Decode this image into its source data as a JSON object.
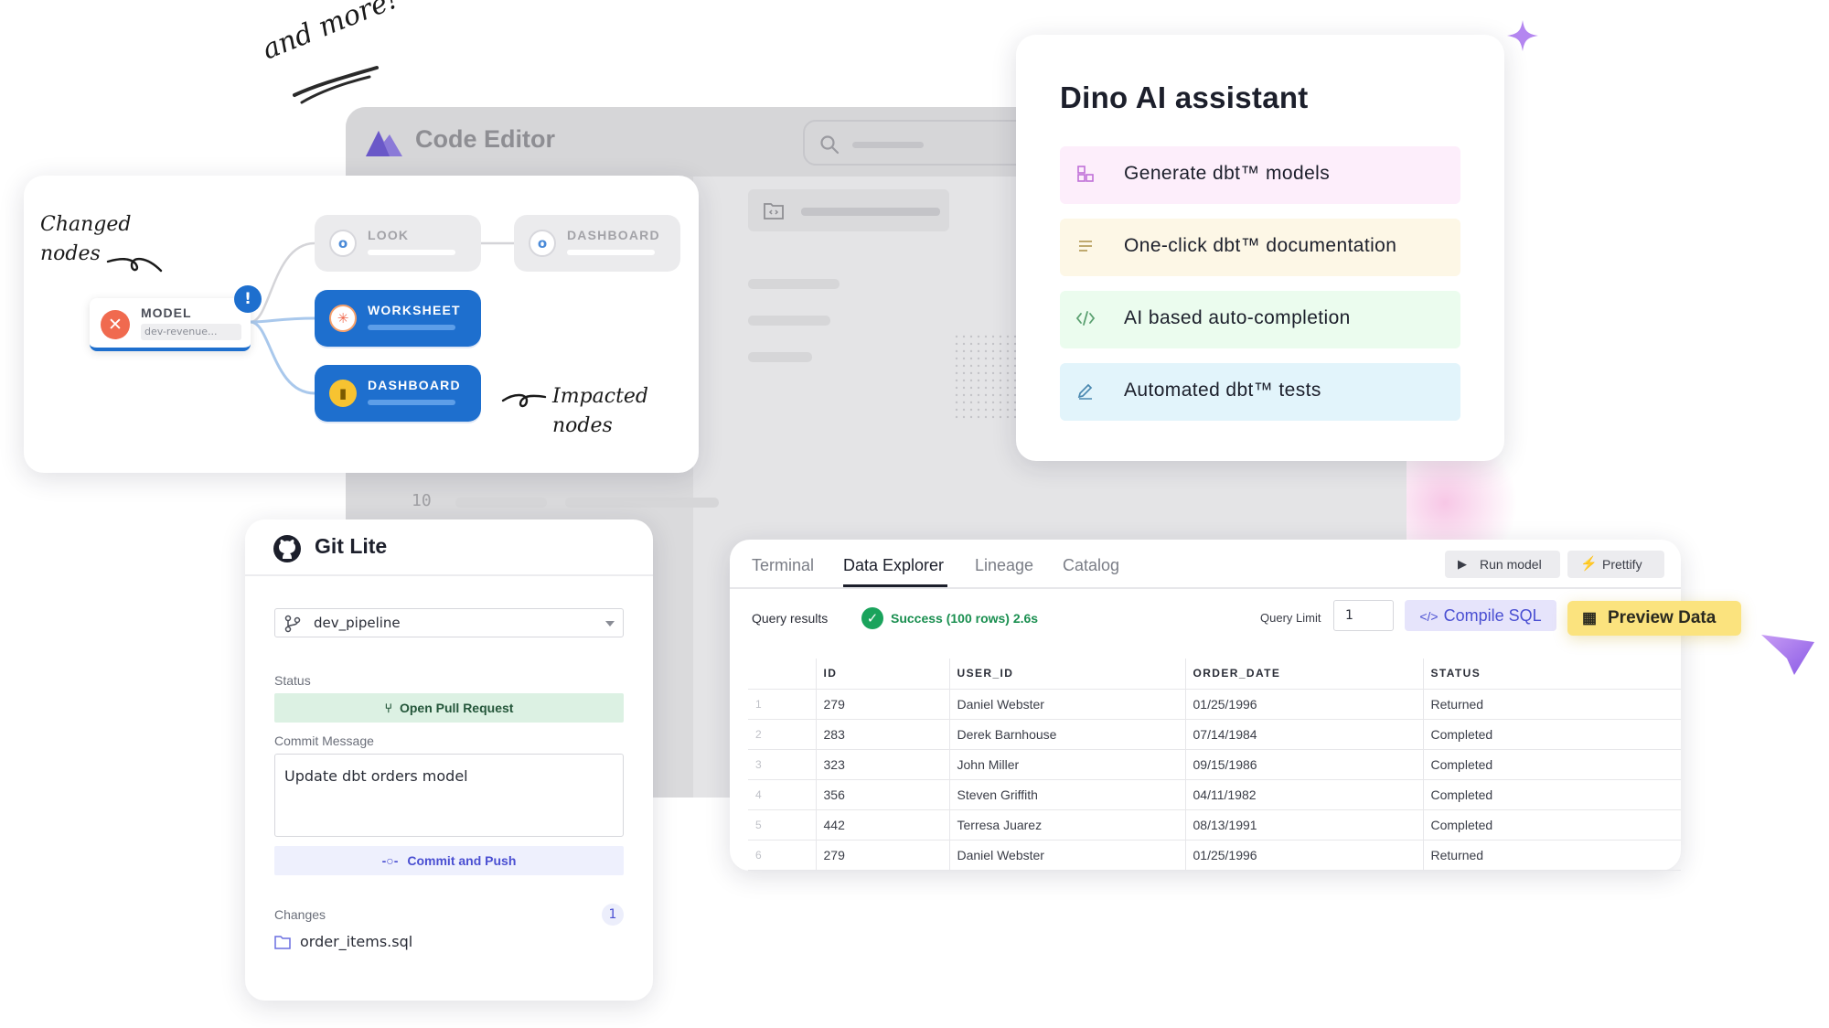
{
  "annotations": {
    "and_more": "and more!",
    "changed_nodes_line1": "Changed",
    "changed_nodes_line2": "nodes",
    "impacted_nodes_line1": "Impacted",
    "impacted_nodes_line2": "nodes"
  },
  "code_editor": {
    "title": "Code Editor",
    "line_number": "10"
  },
  "lineage": {
    "model": {
      "label": "MODEL",
      "sub": "dev-revenue..."
    },
    "nodes": [
      {
        "label": "LOOK",
        "state": "unchanged"
      },
      {
        "label": "DASHBOARD",
        "state": "unchanged"
      },
      {
        "label": "WORKSHEET",
        "state": "impacted"
      },
      {
        "label": "DASHBOARD",
        "state": "impacted"
      }
    ],
    "alert": "!"
  },
  "ai": {
    "title": "Dino AI assistant",
    "items": [
      {
        "label": "Generate dbt™ models",
        "color": "#fdeefb",
        "icon": "models-icon"
      },
      {
        "label": "One-click dbt™ documentation",
        "color": "#fdf7e6",
        "icon": "document-lines-icon"
      },
      {
        "label": "AI based auto-completion",
        "color": "#ebfcee",
        "icon": "code-icon"
      },
      {
        "label": "Automated dbt™ tests",
        "color": "#e2f4fb",
        "icon": "pencil-icon"
      }
    ]
  },
  "git": {
    "title": "Git Lite",
    "branch": "dev_pipeline",
    "status_label": "Status",
    "pr_button": "Open Pull Request",
    "commit_label": "Commit Message",
    "commit_message": "Update dbt orders model",
    "commit_button": "Commit and Push",
    "changes_label": "Changes",
    "changes_count": "1",
    "changed_file": "order_items.sql"
  },
  "explorer": {
    "tabs": [
      "Terminal",
      "Data Explorer",
      "Lineage",
      "Catalog"
    ],
    "active_tab": "Data Explorer",
    "run_button": "Run model",
    "prettify_button": "Prettify",
    "query_results_label": "Query results",
    "success_text": "Success (100 rows) 2.6s",
    "query_limit_label": "Query Limit",
    "query_limit_value": "1",
    "compile_button": "Compile SQL",
    "preview_button": "Preview Data",
    "columns": [
      "",
      "ID",
      "USER_ID",
      "ORDER_DATE",
      "STATUS"
    ],
    "rows": [
      [
        "1",
        "279",
        "Daniel Webster",
        "01/25/1996",
        "Returned"
      ],
      [
        "2",
        "283",
        "Derek Barnhouse",
        "07/14/1984",
        "Completed"
      ],
      [
        "3",
        "323",
        "John Miller",
        "09/15/1986",
        "Completed"
      ],
      [
        "4",
        "356",
        "Steven Griffith",
        "04/11/1982",
        "Completed"
      ],
      [
        "5",
        "442",
        "Terresa Juarez",
        "08/13/1991",
        "Completed"
      ],
      [
        "6",
        "279",
        "Daniel Webster",
        "01/25/1996",
        "Returned"
      ]
    ]
  },
  "colors": {
    "accent_blue": "#1e6fce",
    "accent_purple": "#8b6cf0",
    "success_green": "#1aa35c",
    "preview_yellow": "#fbe37e"
  }
}
